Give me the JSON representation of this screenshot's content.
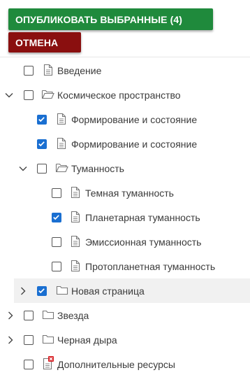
{
  "toolbar": {
    "publish_label": "ОПУБЛИКОВАТЬ ВЫБРАННЫЕ (4)",
    "cancel_label": "ОТМЕНА",
    "publish_color": "#1f8a3c",
    "cancel_color": "#8a0f0f"
  },
  "tree": {
    "items": [
      {
        "label": "Введение",
        "checked": false,
        "icon": "document-icon",
        "expander": "none"
      },
      {
        "label": "Космическое пространство",
        "checked": false,
        "icon": "folder-open-icon",
        "expander": "expanded"
      },
      {
        "label": "Формирование и состояние",
        "checked": true,
        "icon": "document-icon",
        "expander": "none"
      },
      {
        "label": "Формирование и состояние",
        "checked": true,
        "icon": "document-icon",
        "expander": "none"
      },
      {
        "label": "Туманность",
        "checked": false,
        "icon": "folder-open-icon",
        "expander": "expanded"
      },
      {
        "label": "Темная туманность",
        "checked": false,
        "icon": "document-icon",
        "expander": "none"
      },
      {
        "label": "Планетарная туманность",
        "checked": true,
        "icon": "document-icon",
        "expander": "none"
      },
      {
        "label": "Эмиссионная туманность",
        "checked": false,
        "icon": "document-icon",
        "expander": "none"
      },
      {
        "label": "Протопланетная туманность",
        "checked": false,
        "icon": "document-icon",
        "expander": "none"
      },
      {
        "label": "Новая страница",
        "checked": true,
        "icon": "folder-icon",
        "expander": "collapsed"
      },
      {
        "label": "Звезда",
        "checked": false,
        "icon": "folder-icon",
        "expander": "collapsed"
      },
      {
        "label": "Черная дыра",
        "checked": false,
        "icon": "folder-icon",
        "expander": "collapsed"
      },
      {
        "label": "Дополнительные ресурсы",
        "checked": false,
        "icon": "document-error-icon",
        "expander": "none"
      }
    ]
  }
}
